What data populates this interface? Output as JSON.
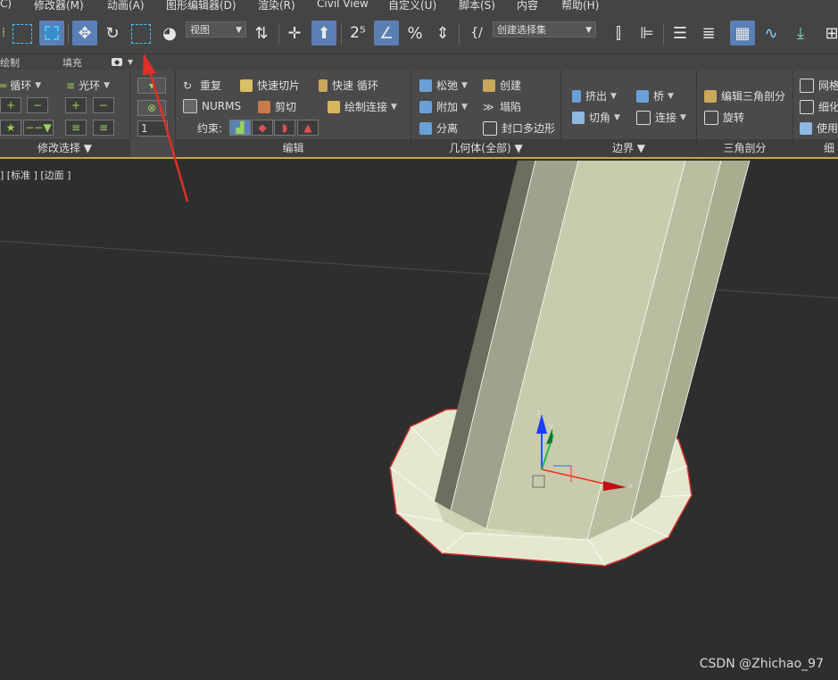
{
  "menu": [
    "C)",
    "修改器(M)",
    "动画(A)",
    "图形编辑器(D)",
    "渲染(R)",
    "Civil View",
    "自定义(U)",
    "脚本(S)",
    "内容",
    "帮助(H)"
  ],
  "toolbar": {
    "view_dropdown": "视图",
    "selection_set_dropdown": "创建选择集"
  },
  "tabs": [
    "绘制",
    "填充"
  ],
  "ribbon": {
    "modify_selection": {
      "footer": "修改选择",
      "loop": "循环",
      "ring": "光环"
    },
    "edit": {
      "footer": "编辑",
      "repeat": "重复",
      "quickslice": "快速切片",
      "swiftloop": "快速 循环",
      "nurms": "NURMS",
      "cut": "剪切",
      "paintconnect": "绘制连接",
      "constraint": "约束:",
      "spinner_value": "1"
    },
    "geometry": {
      "footer": "几何体(全部)",
      "relax": "松弛",
      "create": "创建",
      "attach": "附加",
      "collapse": "塌陷",
      "detach": "分离",
      "cap": "封口多边形"
    },
    "borders": {
      "footer": "边界",
      "extrude": "挤出",
      "bridge": "桥",
      "chamfer": "切角",
      "connect": "连接"
    },
    "tris": {
      "footer": "三角剖分",
      "edit_tri": "编辑三角剖分",
      "turn": "旋转"
    },
    "subdiv": {
      "footer": "细分",
      "mesh": "网格",
      "tess": "细化",
      "use": "使用"
    }
  },
  "viewport": {
    "label": "] [标准 ] [边面 ]",
    "axis_x": "x",
    "axis_y": "y",
    "axis_z": "z"
  },
  "watermark": "CSDN @Zhichao_97",
  "colors": {
    "accent": "#5a7fb5",
    "viewport_border": "#c8a64a",
    "annotation_arrow": "#e03028",
    "model_face": "#c9ccac",
    "model_base": "#e5e8cf"
  }
}
